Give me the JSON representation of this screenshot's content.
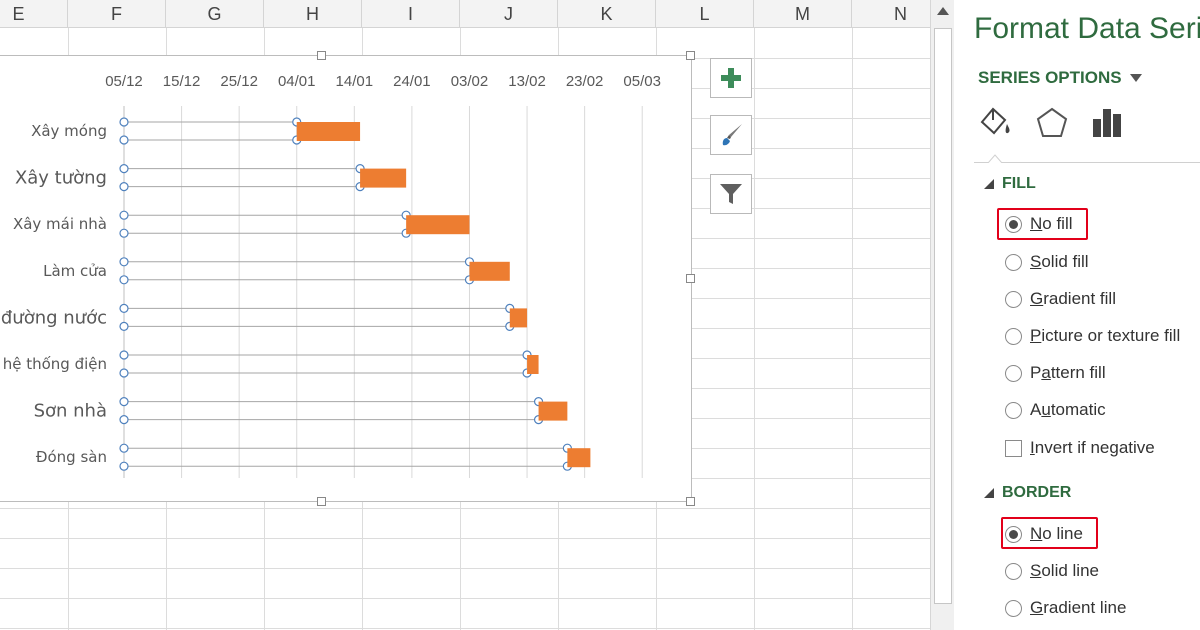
{
  "sheet": {
    "columns": [
      "E",
      "F",
      "G",
      "H",
      "I",
      "J",
      "K",
      "L",
      "M",
      "N"
    ]
  },
  "chart_data": {
    "type": "bar",
    "subtype": "gantt",
    "categories": [
      "Xây móng",
      "Xây tường",
      "Xây mái nhà",
      "Làm cửa",
      "đường nước",
      "hệ thống điện",
      "Sơn nhà",
      "Đóng sàn"
    ],
    "x_tick_labels": [
      "05/12",
      "15/12",
      "25/12",
      "04/01",
      "14/01",
      "24/01",
      "03/02",
      "13/02",
      "23/02",
      "05/03"
    ],
    "x_axis_position": "top",
    "series": [
      {
        "role": "start",
        "fill": "none",
        "values": [
          "2014-01-04",
          "2014-01-15",
          "2014-01-23",
          "2014-02-03",
          "2014-02-10",
          "2014-02-13",
          "2014-02-15",
          "2014-02-20"
        ]
      },
      {
        "role": "duration_days",
        "color": "#ed7d31",
        "values": [
          11,
          8,
          11,
          7,
          3,
          2,
          5,
          4
        ]
      }
    ],
    "grid": "vertical",
    "legend": "none"
  },
  "chart_tools": {
    "buttons": [
      {
        "icon": "plus-icon"
      },
      {
        "icon": "paintbrush-icon"
      },
      {
        "icon": "filter-icon"
      }
    ]
  },
  "pane": {
    "title": "Format Data Series",
    "series_options": "SERIES OPTIONS",
    "tabs": [
      {
        "icon": "paint-bucket-icon"
      },
      {
        "icon": "pentagon-icon"
      },
      {
        "icon": "bar-chart-icon"
      }
    ],
    "fill": {
      "header": "FILL",
      "options": [
        {
          "key": "N",
          "rest": "o fill",
          "selected": true
        },
        {
          "key": "S",
          "rest": "olid fill",
          "selected": false
        },
        {
          "key": "G",
          "rest": "radient fill",
          "selected": false
        },
        {
          "key": "P",
          "rest": "icture or texture fill",
          "selected": false
        },
        {
          "prefix": "P",
          "key": "a",
          "rest": "ttern fill",
          "selected": false
        },
        {
          "prefix": "A",
          "key": "u",
          "rest": "tomatic",
          "selected": false
        }
      ],
      "invert": {
        "key": "I",
        "rest": "nvert if negative",
        "checked": false
      }
    },
    "border": {
      "header": "BORDER",
      "options": [
        {
          "key": "N",
          "rest": "o line",
          "selected": true
        },
        {
          "key": "S",
          "rest": "olid line",
          "selected": false
        },
        {
          "key": "G",
          "rest": "radient line",
          "selected": false
        }
      ]
    },
    "highlight_color": "#e2001a",
    "accent_color": "#2f6b3f"
  }
}
